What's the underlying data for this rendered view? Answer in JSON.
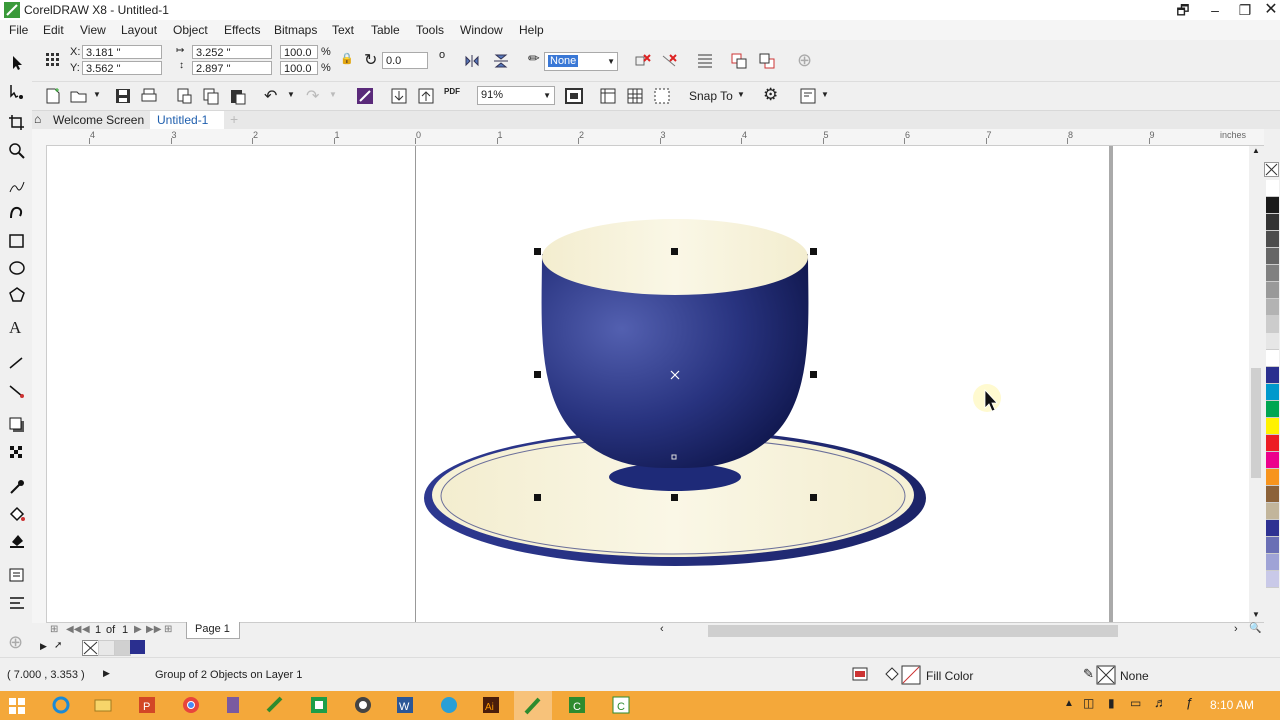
{
  "window": {
    "title": "CorelDRAW X8 - Untitled-1"
  },
  "menu": [
    "File",
    "Edit",
    "View",
    "Layout",
    "Object",
    "Effects",
    "Bitmaps",
    "Text",
    "Table",
    "Tools",
    "Window",
    "Help"
  ],
  "property_bar": {
    "x_label": "X:",
    "x_value": "3.181 \"",
    "y_label": "Y:",
    "y_value": "3.562 \"",
    "w_value": "3.252 \"",
    "h_value": "2.897 \"",
    "scale_x": "100.0",
    "scale_y": "100.0",
    "pct": "%",
    "rotation": "0.0",
    "degree": "o",
    "outline": "None"
  },
  "standard_bar": {
    "zoom": "91%",
    "snap_label": "Snap To",
    "pdf_label": "PDF"
  },
  "tabs": {
    "welcome": "Welcome Screen",
    "doc": "Untitled-1",
    "add": "+"
  },
  "ruler": {
    "units": "inches",
    "labels": [
      "4",
      "3",
      "2",
      "1",
      "0",
      "1",
      "2",
      "3",
      "4",
      "5",
      "6",
      "7",
      "8",
      "9"
    ]
  },
  "pagenav": {
    "current": "1",
    "of": "of",
    "total": "1",
    "page_tab": "Page 1"
  },
  "status": {
    "coords": "( 7.000 , 3.353 )",
    "selection": "Group of 2 Objects on Layer 1",
    "fill": "Fill Color",
    "outline": "None"
  },
  "taskbar": {
    "time": "8:10 AM"
  },
  "colors": {
    "cup_blue": "#2a3a8c",
    "cream": "#f6f1d8",
    "accent_blue": "#1f6fbf",
    "taskbar": "#f4a83a"
  },
  "palette": [
    "#ffffff",
    "#1a1a1a",
    "#333333",
    "#4d4d4d",
    "#666666",
    "#808080",
    "#999999",
    "#b3b3b3",
    "#cccccc",
    "#e6e6e6",
    "#ffffff",
    "#2a2f8f",
    "#0099cc",
    "#00a651",
    "#fff200",
    "#ed1c24",
    "#ec008c",
    "#f7941d",
    "#8c6239",
    "#c2b59b",
    "#2e3192",
    "#6a6fb5",
    "#9fa3d6",
    "#c9c9e8"
  ]
}
